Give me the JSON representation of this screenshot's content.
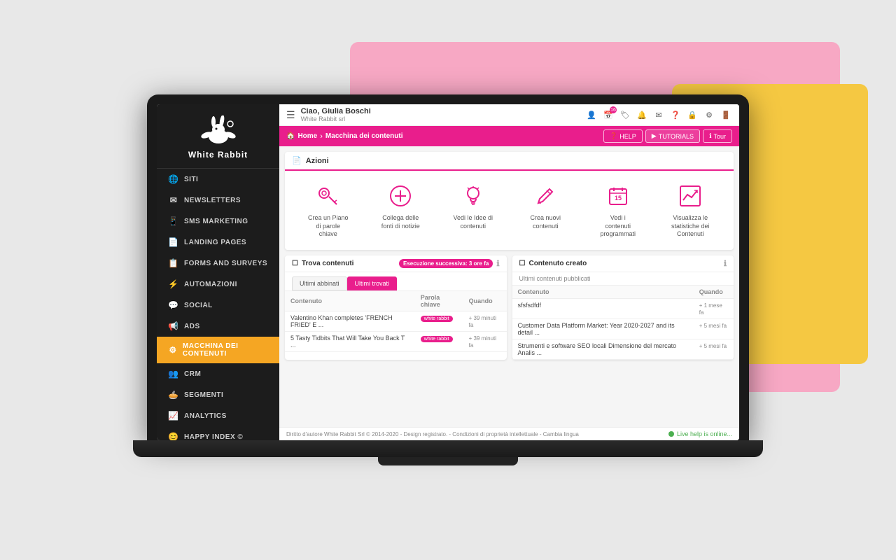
{
  "background": {
    "pink_shape": "decorative",
    "yellow_shape": "decorative"
  },
  "sidebar": {
    "logo_text": "White Rabbit",
    "nav_items": [
      {
        "id": "siti",
        "label": "SITI",
        "icon": "🌐",
        "active": false
      },
      {
        "id": "newsletters",
        "label": "NEWSLETTERS",
        "icon": "✉",
        "active": false
      },
      {
        "id": "sms",
        "label": "SMS MARKETING",
        "icon": "📱",
        "active": false
      },
      {
        "id": "landing",
        "label": "LANDING PAGES",
        "icon": "📄",
        "active": false
      },
      {
        "id": "forms",
        "label": "FORMS AND SURVEYS",
        "icon": "📋",
        "active": false
      },
      {
        "id": "automazioni",
        "label": "AUTOMAZIONI",
        "icon": "⚡",
        "active": false
      },
      {
        "id": "social",
        "label": "SOCIAL",
        "icon": "💬",
        "active": false
      },
      {
        "id": "ads",
        "label": "ADS",
        "icon": "📢",
        "active": false
      },
      {
        "id": "macchina",
        "label": "MACCHINA DEI CONTENUTI",
        "icon": "⚙",
        "active": true
      },
      {
        "id": "crm",
        "label": "CRM",
        "icon": "👥",
        "active": false
      },
      {
        "id": "segmenti",
        "label": "SEGMENTI",
        "icon": "🥧",
        "active": false
      },
      {
        "id": "analytics",
        "label": "ANALYTICS",
        "icon": "📈",
        "active": false
      },
      {
        "id": "happy",
        "label": "HAPPY INDEX ©",
        "icon": "😊",
        "active": false
      }
    ]
  },
  "topbar": {
    "greeting": "Ciao, Giulia Boschi",
    "company": "White Rabbit srl",
    "badge_count": "16"
  },
  "breadcrumb": {
    "home_label": "Home",
    "page_label": "Macchina dei contenuti",
    "help_label": "HELP",
    "tutorials_label": "TUTORIALS",
    "tour_label": "Tour"
  },
  "azioni": {
    "header": "Azioni",
    "items": [
      {
        "label": "Crea un Piano di parole chiave",
        "icon": "key"
      },
      {
        "label": "Collega delle fonti di notizie",
        "icon": "plus-circle"
      },
      {
        "label": "Vedi le Idee di contenuti",
        "icon": "lightbulb"
      },
      {
        "label": "Crea nuovi contenuti",
        "icon": "pencil"
      },
      {
        "label": "Vedi i contenuti programmati",
        "icon": "calendar"
      },
      {
        "label": "Visualizza le statistiche dei Contenuti",
        "icon": "chart"
      }
    ]
  },
  "trova_contenuti": {
    "header": "Trova contenuti",
    "badge": "Esecuzione successiva: 3 ore fa",
    "tabs": [
      "Ultimi abbinati",
      "Ultimi trovati"
    ],
    "active_tab": 1,
    "columns": [
      "Contenuto",
      "Parola chiave",
      "Quando"
    ],
    "rows": [
      {
        "contenuto": "Valentino Khan completes 'FRENCH FRIED' E ...",
        "keyword": "white rabbit",
        "quando": "+ 39 minuti fa"
      },
      {
        "contenuto": "5 Tasty Tidbits That Will Take You Back T ...",
        "keyword": "white rabbit",
        "quando": "+ 39 minuti fa"
      }
    ]
  },
  "contenuto_creato": {
    "header": "Contenuto creato",
    "sub_header": "Ultimi contenuti pubblicati",
    "columns": [
      "Contenuto",
      "Quando"
    ],
    "rows": [
      {
        "contenuto": "sfsfsdfdf",
        "quando": "+ 1 mese fa"
      },
      {
        "contenuto": "Customer Data Platform Market: Year 2020-2027 and its detail ...",
        "quando": "+ 5 mesi fa"
      },
      {
        "contenuto": "Strumenti e software SEO locali Dimensione del mercato Analis ...",
        "quando": "+ 5 mesi fa"
      }
    ]
  },
  "footer": {
    "copyright": "Diritto d'autore White Rabbit Srl © 2014-2020 - Design registrato. - Condizioni di proprietà intellettuale - Cambia lingua",
    "live_help": "Live help is online..."
  }
}
